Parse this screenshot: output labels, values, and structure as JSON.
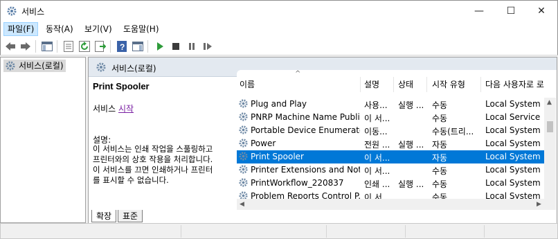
{
  "window": {
    "title": "서비스",
    "minimize_glyph": "—",
    "maximize_glyph": "☐",
    "close_glyph": "✕"
  },
  "menu": {
    "items": [
      "파일(F)",
      "동작(A)",
      "보기(V)",
      "도움말(H)"
    ]
  },
  "toolbar": {
    "icons": [
      "back-arrow-icon",
      "forward-arrow-icon",
      "show-hide-tree-icon",
      "properties-icon",
      "refresh-icon",
      "export-list-icon",
      "help-icon",
      "show-action-pane-icon",
      "start-service-icon",
      "stop-service-icon",
      "pause-service-icon",
      "resume-service-icon"
    ]
  },
  "tree": {
    "item": "서비스(로컬)"
  },
  "main": {
    "header": "서비스(로컬)",
    "selected_service": "Print Spooler",
    "start_prefix": "서비스 ",
    "start_link": "시작",
    "desc_label": "설명:",
    "desc_lines": [
      "이 서비스는 인쇄 작업을 스풀링하고",
      "프린터와의 상호 작용을 처리합니다.",
      "이 서비스를 끄면 인쇄하거나 프린터",
      "를 표시할 수 없습니다."
    ]
  },
  "table": {
    "columns": [
      "이름",
      "설명",
      "상태",
      "시작 유형",
      "다음 사용자로 로"
    ],
    "sort_glyph": "^",
    "rows": [
      {
        "name": "Plug and Play",
        "desc": "사용...",
        "status": "실행 ...",
        "startup": "수동",
        "logon": "Local System"
      },
      {
        "name": "PNRP Machine Name Publi...",
        "desc": "이 서...",
        "status": "",
        "startup": "수동",
        "logon": "Local Service"
      },
      {
        "name": "Portable Device Enumerato...",
        "desc": "이동...",
        "status": "",
        "startup": "수동(트리...",
        "logon": "Local System"
      },
      {
        "name": "Power",
        "desc": "전원 ...",
        "status": "실행 ...",
        "startup": "자동",
        "logon": "Local System"
      },
      {
        "name": "Print Spooler",
        "desc": "이 서...",
        "status": "",
        "startup": "자동",
        "logon": "Local System"
      },
      {
        "name": "Printer Extensions and Noti...",
        "desc": "이 서...",
        "status": "",
        "startup": "수동",
        "logon": "Local System"
      },
      {
        "name": "PrintWorkflow_220837",
        "desc": "인쇄 ...",
        "status": "실행 ...",
        "startup": "수동",
        "logon": "Local System"
      },
      {
        "name": "Problem Reports Control P...",
        "desc": "이 서...",
        "status": "",
        "startup": "수동",
        "logon": "Local System"
      }
    ],
    "selected_index": 4
  },
  "tabs": [
    "확장",
    "표준"
  ],
  "colors": {
    "selection": "#0078d7",
    "link": "#7a1fa2",
    "header_bg": "#e3e9f0"
  }
}
